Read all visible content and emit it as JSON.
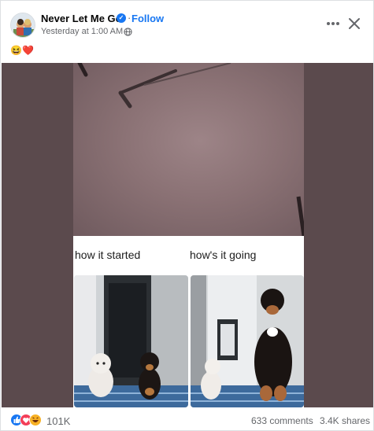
{
  "post": {
    "author": "Never Let Me Go",
    "follow_label": "Follow",
    "timestamp": "Yesterday at 1:00 AM",
    "separator": "·",
    "verified_mark": "✓",
    "body_emoji": "😆❤️"
  },
  "meme": {
    "caption_left": "how it started",
    "caption_right": "how's it going"
  },
  "footer": {
    "reaction_count": "101K",
    "comments": "633 comments",
    "shares": "3.4K shares",
    "reaction_icons": [
      "like-icon",
      "love-icon",
      "haha-icon"
    ]
  },
  "colors": {
    "accent": "#1877f2",
    "secondary_text": "#65676b",
    "media_background": "#5b4a4d"
  }
}
